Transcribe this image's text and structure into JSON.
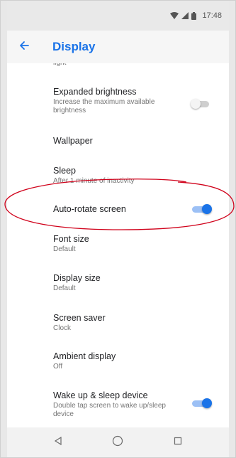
{
  "status_bar": {
    "time": "17:48",
    "icons": [
      "wifi-icon",
      "cell-signal-icon",
      "battery-icon"
    ]
  },
  "app_bar": {
    "title": "Display",
    "back_icon": "arrow-back-icon"
  },
  "settings": {
    "cut_summary": "light",
    "items": [
      {
        "title": "Expanded brightness",
        "summary": "Increase the maximum available brightness",
        "toggle": "off"
      },
      {
        "title": "Wallpaper",
        "summary": ""
      },
      {
        "title": "Sleep",
        "summary": "After 1 minute of inactivity"
      },
      {
        "title": "Auto-rotate screen",
        "summary": "",
        "toggle": "on"
      },
      {
        "title": "Font size",
        "summary": "Default"
      },
      {
        "title": "Display size",
        "summary": "Default"
      },
      {
        "title": "Screen saver",
        "summary": "Clock"
      },
      {
        "title": "Ambient display",
        "summary": "Off"
      },
      {
        "title": "Wake up & sleep device",
        "summary": "Double tap screen to wake up/sleep device",
        "toggle": "on"
      }
    ]
  },
  "annotation": {
    "shape": "ellipse",
    "color": "#d0021b",
    "target": "Auto-rotate screen"
  },
  "nav_bar": {
    "icons": [
      "back-triangle-icon",
      "home-circle-icon",
      "recents-square-icon"
    ]
  },
  "colors": {
    "accent": "#1a73e8",
    "statusbar_bg": "#e9e9e9",
    "appbar_bg": "#f6f6f6"
  }
}
